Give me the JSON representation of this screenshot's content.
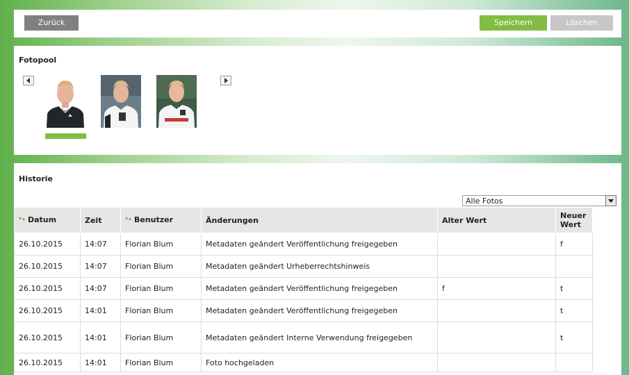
{
  "toolbar": {
    "back_label": "Zurück",
    "save_label": "Speichern",
    "delete_label": "Löschen"
  },
  "fotopool": {
    "title": "Fotopool",
    "photos": [
      "photo-1",
      "photo-2",
      "photo-3"
    ]
  },
  "historie": {
    "title": "Historie",
    "filter_value": "Alle Fotos",
    "columns": {
      "datum": "Datum",
      "zeit": "Zeit",
      "benutzer": "Benutzer",
      "aenderungen": "Änderungen",
      "alter_wert": "Alter Wert",
      "neuer_wert": "Neuer Wert"
    },
    "rows": [
      {
        "datum": "26.10.2015",
        "zeit": "14:07",
        "benutzer": "Florian Blum",
        "aenderungen": "Metadaten geändert Veröffentlichung freigegeben",
        "alter_wert": "",
        "neuer_wert": "f"
      },
      {
        "datum": "26.10.2015",
        "zeit": "14:07",
        "benutzer": "Florian Blum",
        "aenderungen": "Metadaten geändert Urheberrechtshinweis",
        "alter_wert": "",
        "neuer_wert": ""
      },
      {
        "datum": "26.10.2015",
        "zeit": "14:07",
        "benutzer": "Florian Blum",
        "aenderungen": "Metadaten geändert Veröffentlichung freigegeben",
        "alter_wert": "f",
        "neuer_wert": "t"
      },
      {
        "datum": "26.10.2015",
        "zeit": "14:01",
        "benutzer": "Florian Blum",
        "aenderungen": "Metadaten geändert Veröffentlichung freigegeben",
        "alter_wert": "",
        "neuer_wert": "t"
      },
      {
        "datum": "26.10.2015",
        "zeit": "14:01",
        "benutzer": "Florian Blum",
        "aenderungen": "Metadaten geändert Interne Verwendung freigegeben",
        "alter_wert": "",
        "neuer_wert": "t"
      },
      {
        "datum": "26.10.2015",
        "zeit": "14:01",
        "benutzer": "Florian Blum",
        "aenderungen": "Foto hochgeladen",
        "alter_wert": "",
        "neuer_wert": ""
      }
    ]
  },
  "colors": {
    "accent": "#82bc42",
    "button_grey": "#808080",
    "button_disabled": "#c7c7c7",
    "header_bg": "#e6e6e6"
  },
  "icons": [
    "arrow-left-icon",
    "arrow-right-icon",
    "sort-icon",
    "dropdown-arrow-icon"
  ]
}
